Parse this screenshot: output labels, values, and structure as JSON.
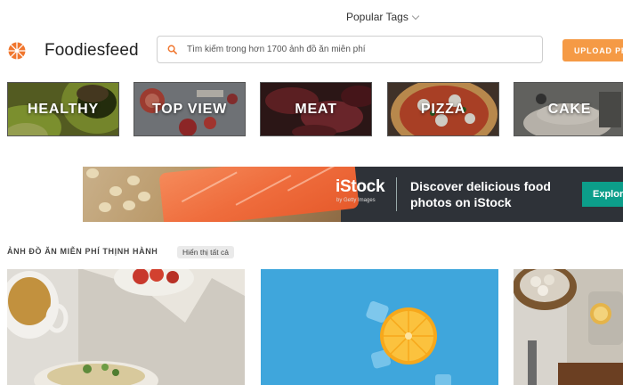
{
  "header": {
    "popular_tags": "Popular Tags",
    "brand": "Foodiesfeed",
    "search_placeholder": "Tìm kiếm trong hơn 1700 ảnh đồ ăn miễn phí",
    "upload_label": "UPLOAD PHO"
  },
  "tags": [
    {
      "label": "HEALTHY"
    },
    {
      "label": "TOP VIEW"
    },
    {
      "label": "MEAT"
    },
    {
      "label": "PIZZA"
    },
    {
      "label": "CAKE"
    }
  ],
  "banner": {
    "brand": "iStock",
    "brand_sub": "by Getty Images",
    "line1": "Discover delicious food",
    "line2": "photos on iStock",
    "cta": "Explor"
  },
  "section": {
    "title": "ẢNH ĐỒ ĂN MIỄN PHÍ THỊNH HÀNH",
    "show_all": "Hiển thị tất cả"
  },
  "colors": {
    "upload_bg": "#f59a45",
    "explore_bg": "#0c9e8a",
    "logo_orange": "#f0762e"
  }
}
